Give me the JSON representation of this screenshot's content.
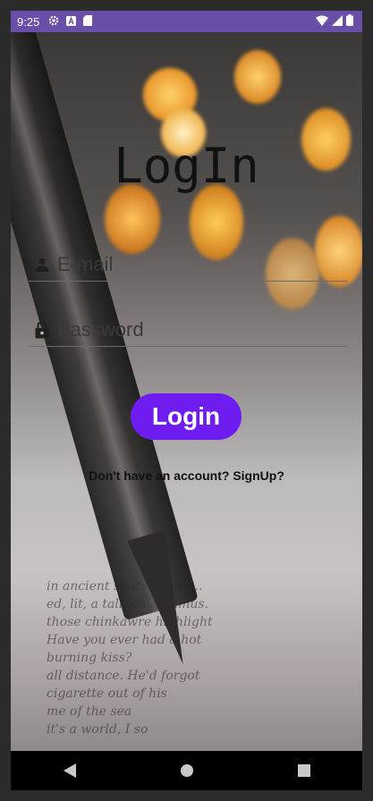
{
  "status_bar": {
    "time": "9:25",
    "left_icons": [
      "gear-icon",
      "a-icon",
      "sd-card-icon"
    ],
    "right_icons": [
      "wifi-icon",
      "signal-icon",
      "battery-icon"
    ],
    "color": "#6A4FA8"
  },
  "screen": {
    "title": "LogIn",
    "email": {
      "placeholder": "E-mail",
      "icon": "person-icon"
    },
    "password": {
      "placeholder": "Password",
      "icon": "lock-icon"
    },
    "login_button": {
      "label": "Login",
      "color": "#6F1CF0"
    },
    "signup_text": "Don't have an account? SignUp?"
  },
  "nav_bar": {
    "buttons": [
      "back-icon",
      "home-icon",
      "recents-icon"
    ]
  }
}
